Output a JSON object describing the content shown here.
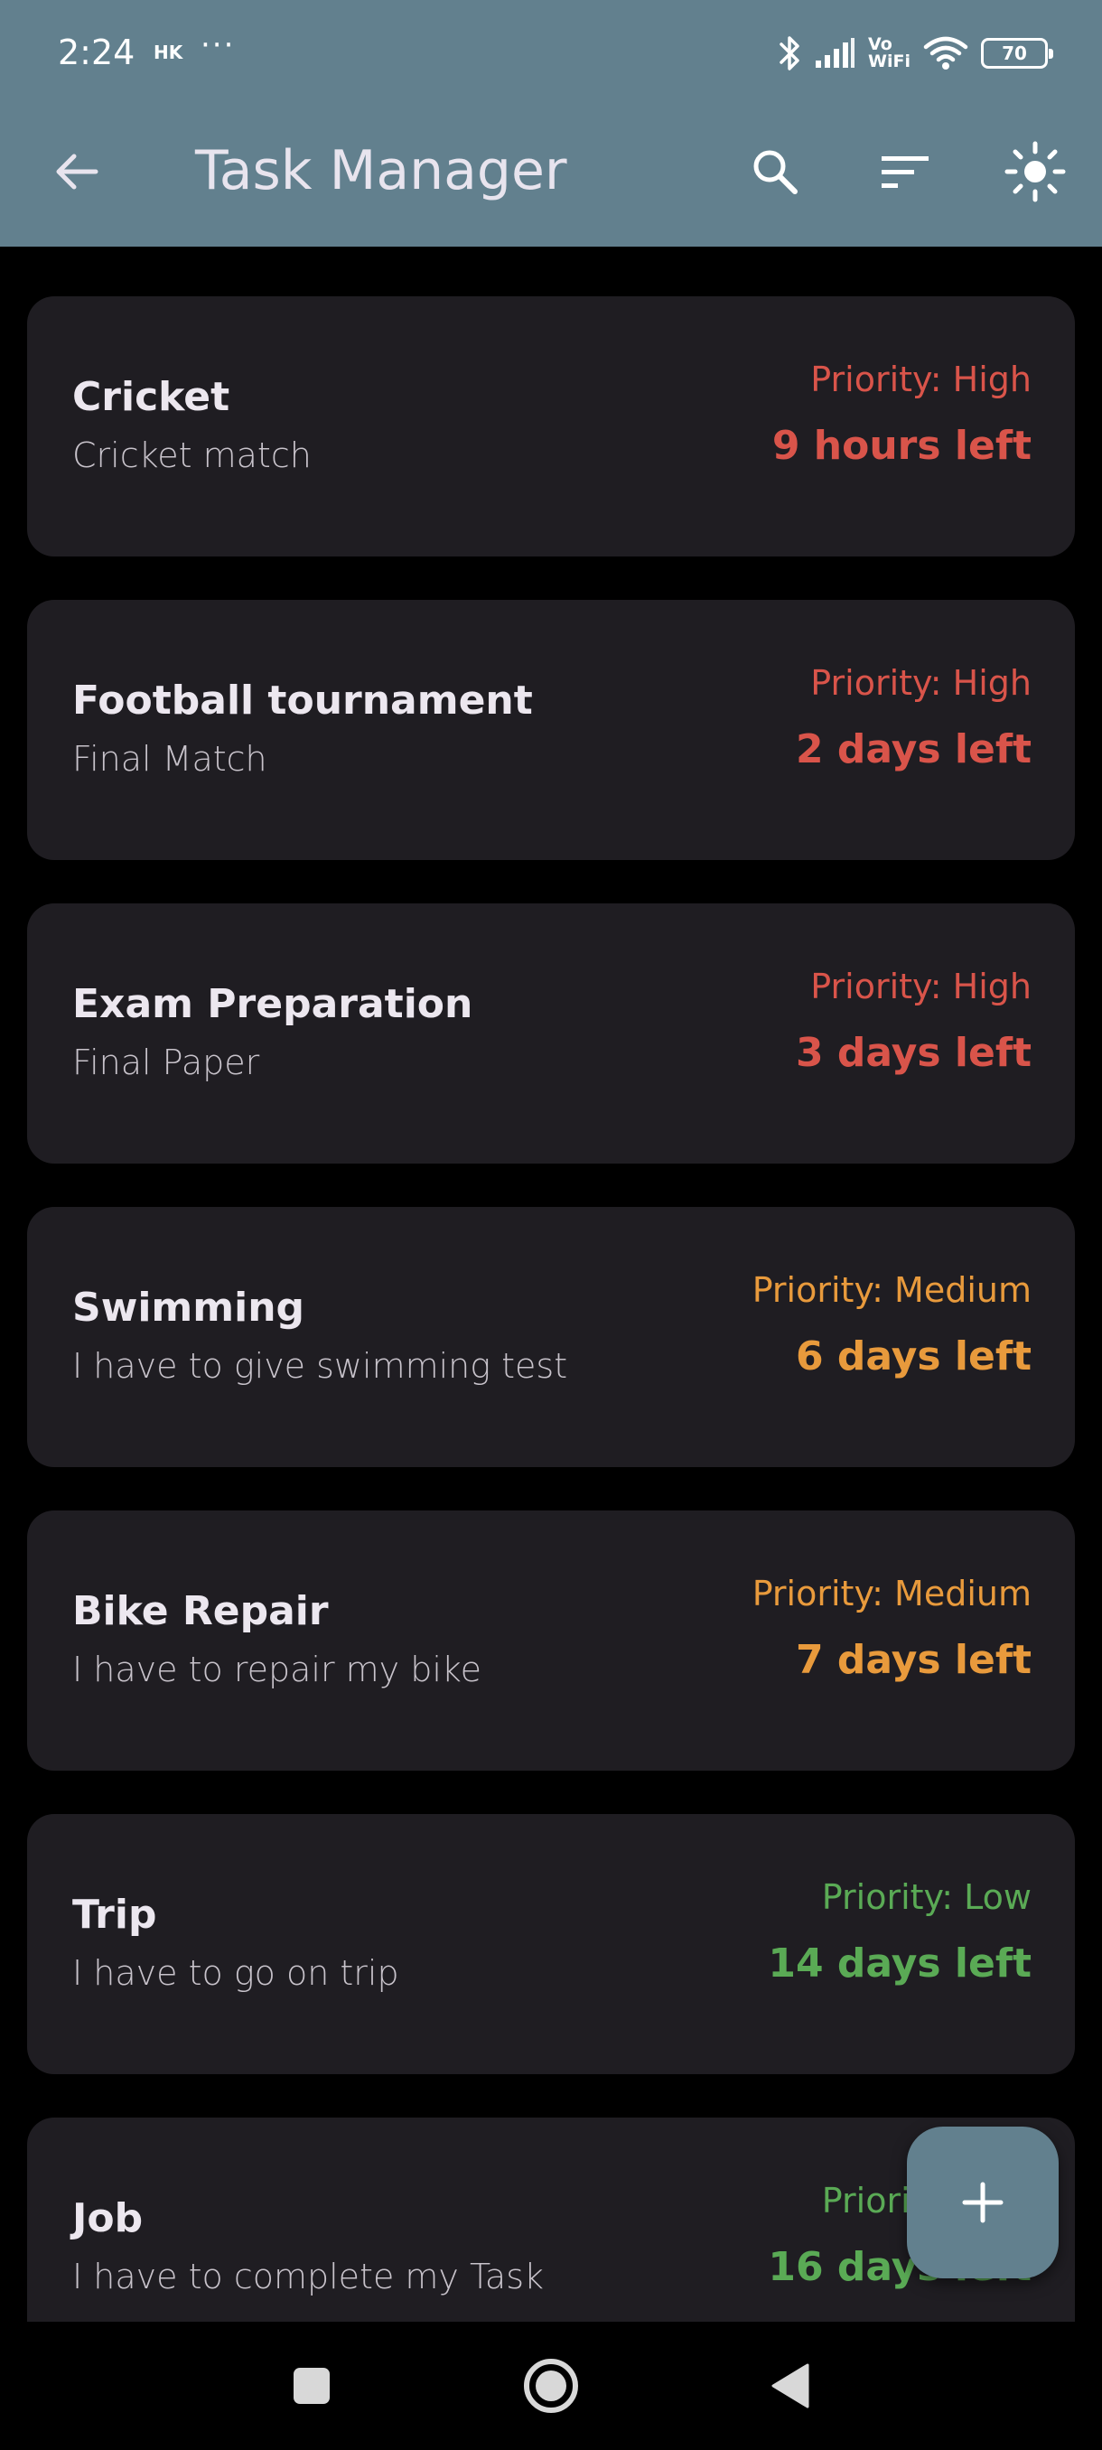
{
  "status_bar": {
    "time": "2:24",
    "carrier_tag": "HK",
    "overflow_dots": "···",
    "volte_top": "Vo",
    "volte_bottom": "WiFi",
    "battery_level": "70"
  },
  "app_bar": {
    "title": "Task Manager",
    "icons": [
      "arrow-back-icon",
      "search-icon",
      "sort-icon",
      "light-mode-icon"
    ]
  },
  "tasks": [
    {
      "title": "Cricket",
      "description": "Cricket match",
      "priority": "Priority: High",
      "time_left": "9 hours left"
    },
    {
      "title": "Football tournament",
      "description": "Final Match",
      "priority": "Priority: High",
      "time_left": "2 days left"
    },
    {
      "title": "Exam Preparation",
      "description": "Final Paper",
      "priority": "Priority: High",
      "time_left": "3 days left"
    },
    {
      "title": "Swimming",
      "description": "I have to give swimming test",
      "priority": "Priority: Medium",
      "time_left": "6 days left"
    },
    {
      "title": "Bike Repair",
      "description": "I have to repair my bike",
      "priority": "Priority: Medium",
      "time_left": "7 days left"
    },
    {
      "title": "Trip",
      "description": "I have to go on trip",
      "priority": "Priority: Low",
      "time_left": "14 days left"
    },
    {
      "title": "Job",
      "description": "I have to complete my Task",
      "priority": "Priority: Low",
      "time_left": "16 days left"
    }
  ],
  "colors": {
    "app_bar": "#62808e",
    "card_background": "#1f1d22",
    "priority_high": "#d9544a",
    "priority_medium": "#e89a3c",
    "priority_low": "#5aaa55"
  },
  "fab": {
    "icon": "plus-icon"
  },
  "nav_bar": {
    "icons": [
      "recents-icon",
      "home-icon",
      "back-icon"
    ]
  }
}
